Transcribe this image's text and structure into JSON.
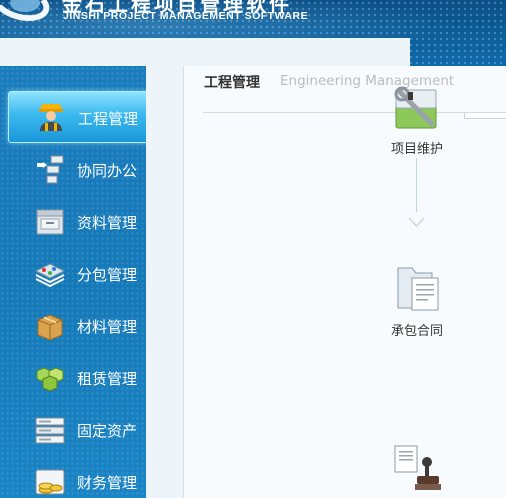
{
  "app": {
    "title_cn": "金石工程项目管理软件",
    "title_en": "JINSHI PROJECT MANAGEMENT SOFTWARE"
  },
  "sidebar": {
    "items": [
      {
        "label": "工程管理",
        "icon": "worker-icon",
        "active": true
      },
      {
        "label": "协同办公",
        "icon": "network-icon",
        "active": false
      },
      {
        "label": "资料管理",
        "icon": "cabinet-icon",
        "active": false
      },
      {
        "label": "分包管理",
        "icon": "layers-icon",
        "active": false
      },
      {
        "label": "材料管理",
        "icon": "box-icon",
        "active": false
      },
      {
        "label": "租赁管理",
        "icon": "cubes-icon",
        "active": false
      },
      {
        "label": "固定资产",
        "icon": "server-icon",
        "active": false
      },
      {
        "label": "财务管理",
        "icon": "coins-icon",
        "active": false
      }
    ]
  },
  "main": {
    "title": "工程管理",
    "subtitle": "Engineering Management",
    "flow": [
      {
        "label": "项目维护",
        "icon": "wrench-icon"
      },
      {
        "label": "承包合同",
        "icon": "folder-icon"
      },
      {
        "label": "",
        "icon": "stamp-icon"
      }
    ]
  },
  "colors": {
    "header_bg": "#0f6aa8",
    "sidebar_bg": "#1a7cbd",
    "active_item": "#3bb9ef",
    "content_bg": "#f8fbfd"
  }
}
